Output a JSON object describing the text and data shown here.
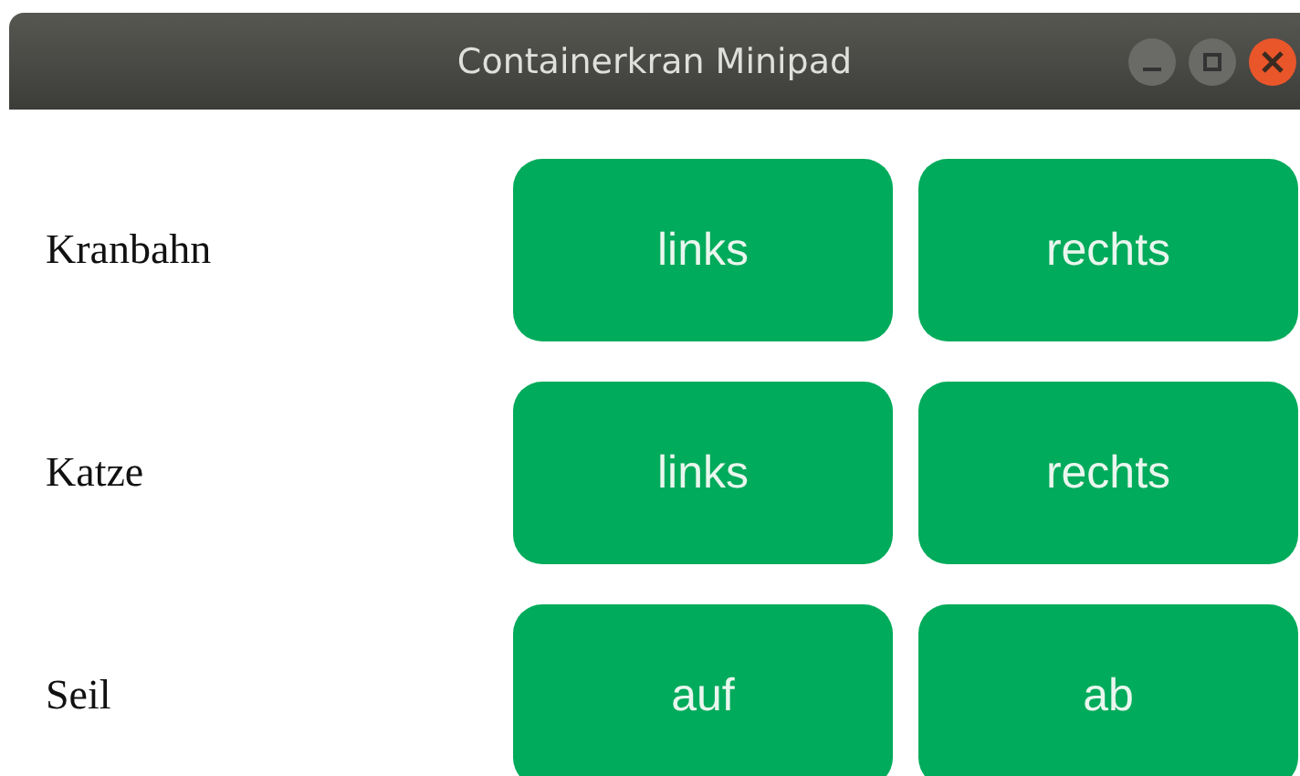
{
  "window": {
    "title": "Containerkran Minipad"
  },
  "rows": [
    {
      "label": "Kranbahn",
      "buttons": [
        "links",
        "rechts"
      ]
    },
    {
      "label": "Katze",
      "buttons": [
        "links",
        "rechts"
      ]
    },
    {
      "label": "Seil",
      "buttons": [
        "auf",
        "ab"
      ]
    }
  ]
}
